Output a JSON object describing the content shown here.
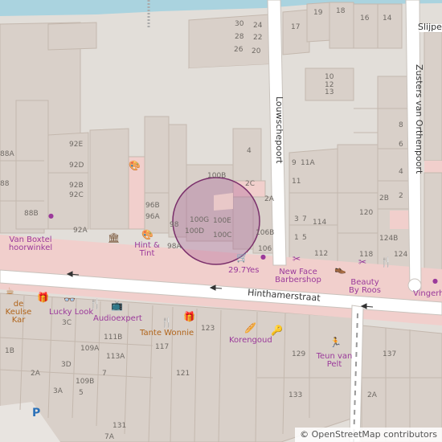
{
  "colors": {
    "building": "#d9d0c9",
    "building_edge": "#c4b8ae",
    "road": "#ffffff",
    "pedestrian": "#f3d0cf",
    "water": "#aad3df",
    "land": "#e2ded9",
    "poi_purple": "#9b3a9b",
    "poi_orange": "#b0641a",
    "selection_fill": "#a0508f",
    "selection_stroke": "#7a2f6b"
  },
  "streets": {
    "main": "Hinthamerstraat",
    "louwscheport": "Louwschepoort",
    "zusters": "Zusters van Orthenpoort",
    "slijper": "Slijpe"
  },
  "house_numbers": [
    "19",
    "18",
    "16",
    "14",
    "17",
    "30",
    "24",
    "28",
    "22",
    "26",
    "20",
    "10",
    "12",
    "13",
    "8",
    "6",
    "4",
    "2",
    "88A",
    "88",
    "92E",
    "92D",
    "92B",
    "92C",
    "88B",
    "96B",
    "96A",
    "92A",
    "98",
    "98A",
    "100G",
    "100E",
    "100D",
    "100C",
    "100B",
    "2C",
    "2A",
    "106B",
    "106",
    "4",
    "9",
    "11A",
    "11",
    "3",
    "7",
    "1",
    "5",
    "114",
    "112",
    "120",
    "118",
    "124B",
    "124",
    "2B",
    "3C",
    "1B",
    "2A",
    "3D",
    "3A",
    "109A",
    "111B",
    "113A",
    "117",
    "123",
    "121",
    "129",
    "109B",
    "5",
    "7",
    "131",
    "133",
    "137",
    "2A",
    "7A"
  ],
  "pois": {
    "van_boxtel": "Van Boxtel hoorwinkel",
    "hint_tint": "Hint & Tint",
    "yes": "29.7Yes",
    "new_face": "New Face Barbershop",
    "beauty": "Beauty By Roos",
    "vingerh": "Vingerh",
    "keulse_kar": "de Keulse Kar",
    "lucky_look": "Lucky Look",
    "audioexpert": "Audioexpert",
    "tante_wonnie": "Tante Wonnie",
    "korengoud": "Korengoud",
    "teun": "Teun van Pelt"
  },
  "icons": [
    "hearing-aid-icon",
    "museum-icon",
    "art-shop-icon",
    "supermarket-basket-icon",
    "barber-icon",
    "shoe-shop-icon",
    "restaurant-icon",
    "cafe-icon",
    "gift-icon",
    "glasses-icon",
    "tv-icon",
    "fast-food-icon",
    "ice-cream-icon",
    "bakery-icon",
    "toy-icon",
    "parking-icon",
    "swing-icon"
  ],
  "parking_label": "P",
  "attribution": {
    "symbol": "©",
    "text": "OpenStreetMap contributors"
  }
}
